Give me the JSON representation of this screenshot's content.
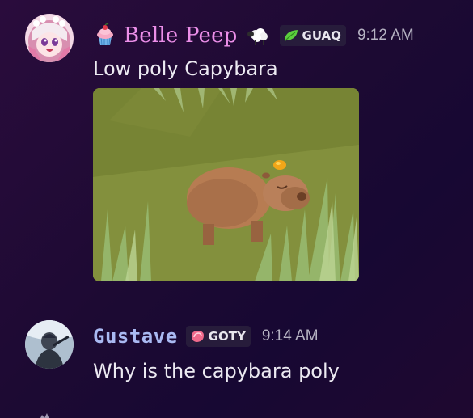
{
  "messages": [
    {
      "author": "Belle Peep",
      "author_color": "#ec8fe9",
      "role_icon": "cupcake-icon",
      "extra_icon": "sheep-icon",
      "guild_tag": {
        "icon": "leaf-icon",
        "text": "GUAQ"
      },
      "timestamp": "9:12 AM",
      "text": "Low poly Capybara",
      "attachment": {
        "type": "image",
        "subject": "low-poly-capybara-with-orange"
      }
    },
    {
      "author": "Gustave",
      "author_color": "#a9b9f2",
      "guild_tag": {
        "icon": "steak-icon",
        "text": "GOTY"
      },
      "timestamp": "9:14 AM",
      "text": "Why is the capybara poly"
    }
  ]
}
